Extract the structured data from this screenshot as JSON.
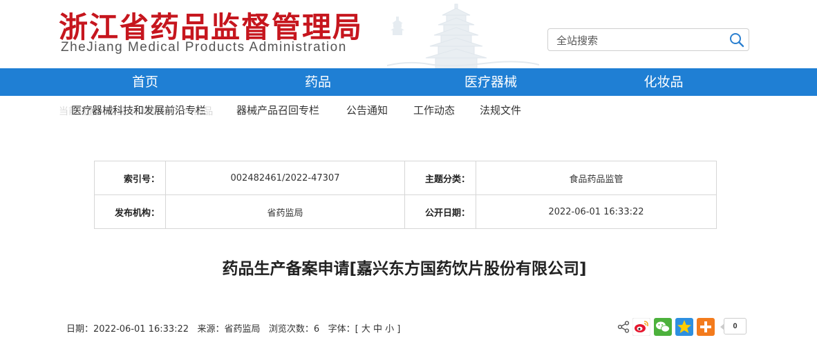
{
  "header": {
    "site_title": "浙江省药品监督管理局",
    "site_subtitle": "ZheJiang Medical Products Administration",
    "search_placeholder": "全站搜索"
  },
  "nav": {
    "items": [
      "首页",
      "药品",
      "医疗器械",
      "化妆品"
    ]
  },
  "subnav": {
    "breadcrumb_ghost": "当前位置：首页 > 政务公开 > 药品",
    "items": [
      "医疗器械科技和发展前沿专栏",
      "器械产品召回专栏",
      "公告通知",
      "工作动态",
      "法规文件"
    ]
  },
  "meta": {
    "index_label": "索引号：",
    "index_value": "002482461/2022-47307",
    "topic_label": "主题分类：",
    "topic_value": "食品药品监管",
    "issuer_label": "发布机构：",
    "issuer_value": "省药监局",
    "date_label": "公开日期：",
    "date_value": "2022-06-01 16:33:22"
  },
  "article": {
    "title": "药品生产备案申请[嘉兴东方国药饮片股份有限公司]",
    "date_text": "日期：2022-06-01 16:33:22",
    "source_text": "来源：省药监局",
    "views_text": "浏览次数：6",
    "font_label": "字体：[",
    "font_large": "大",
    "font_medium": "中",
    "font_small": "小",
    "font_close": "]"
  },
  "share": {
    "icons": [
      "share-icon",
      "weibo-icon",
      "wechat-icon",
      "qzone-icon",
      "more-icon"
    ],
    "count": "0"
  },
  "colors": {
    "brand_red": "#c6161e",
    "nav_blue": "#1f7fd4"
  }
}
